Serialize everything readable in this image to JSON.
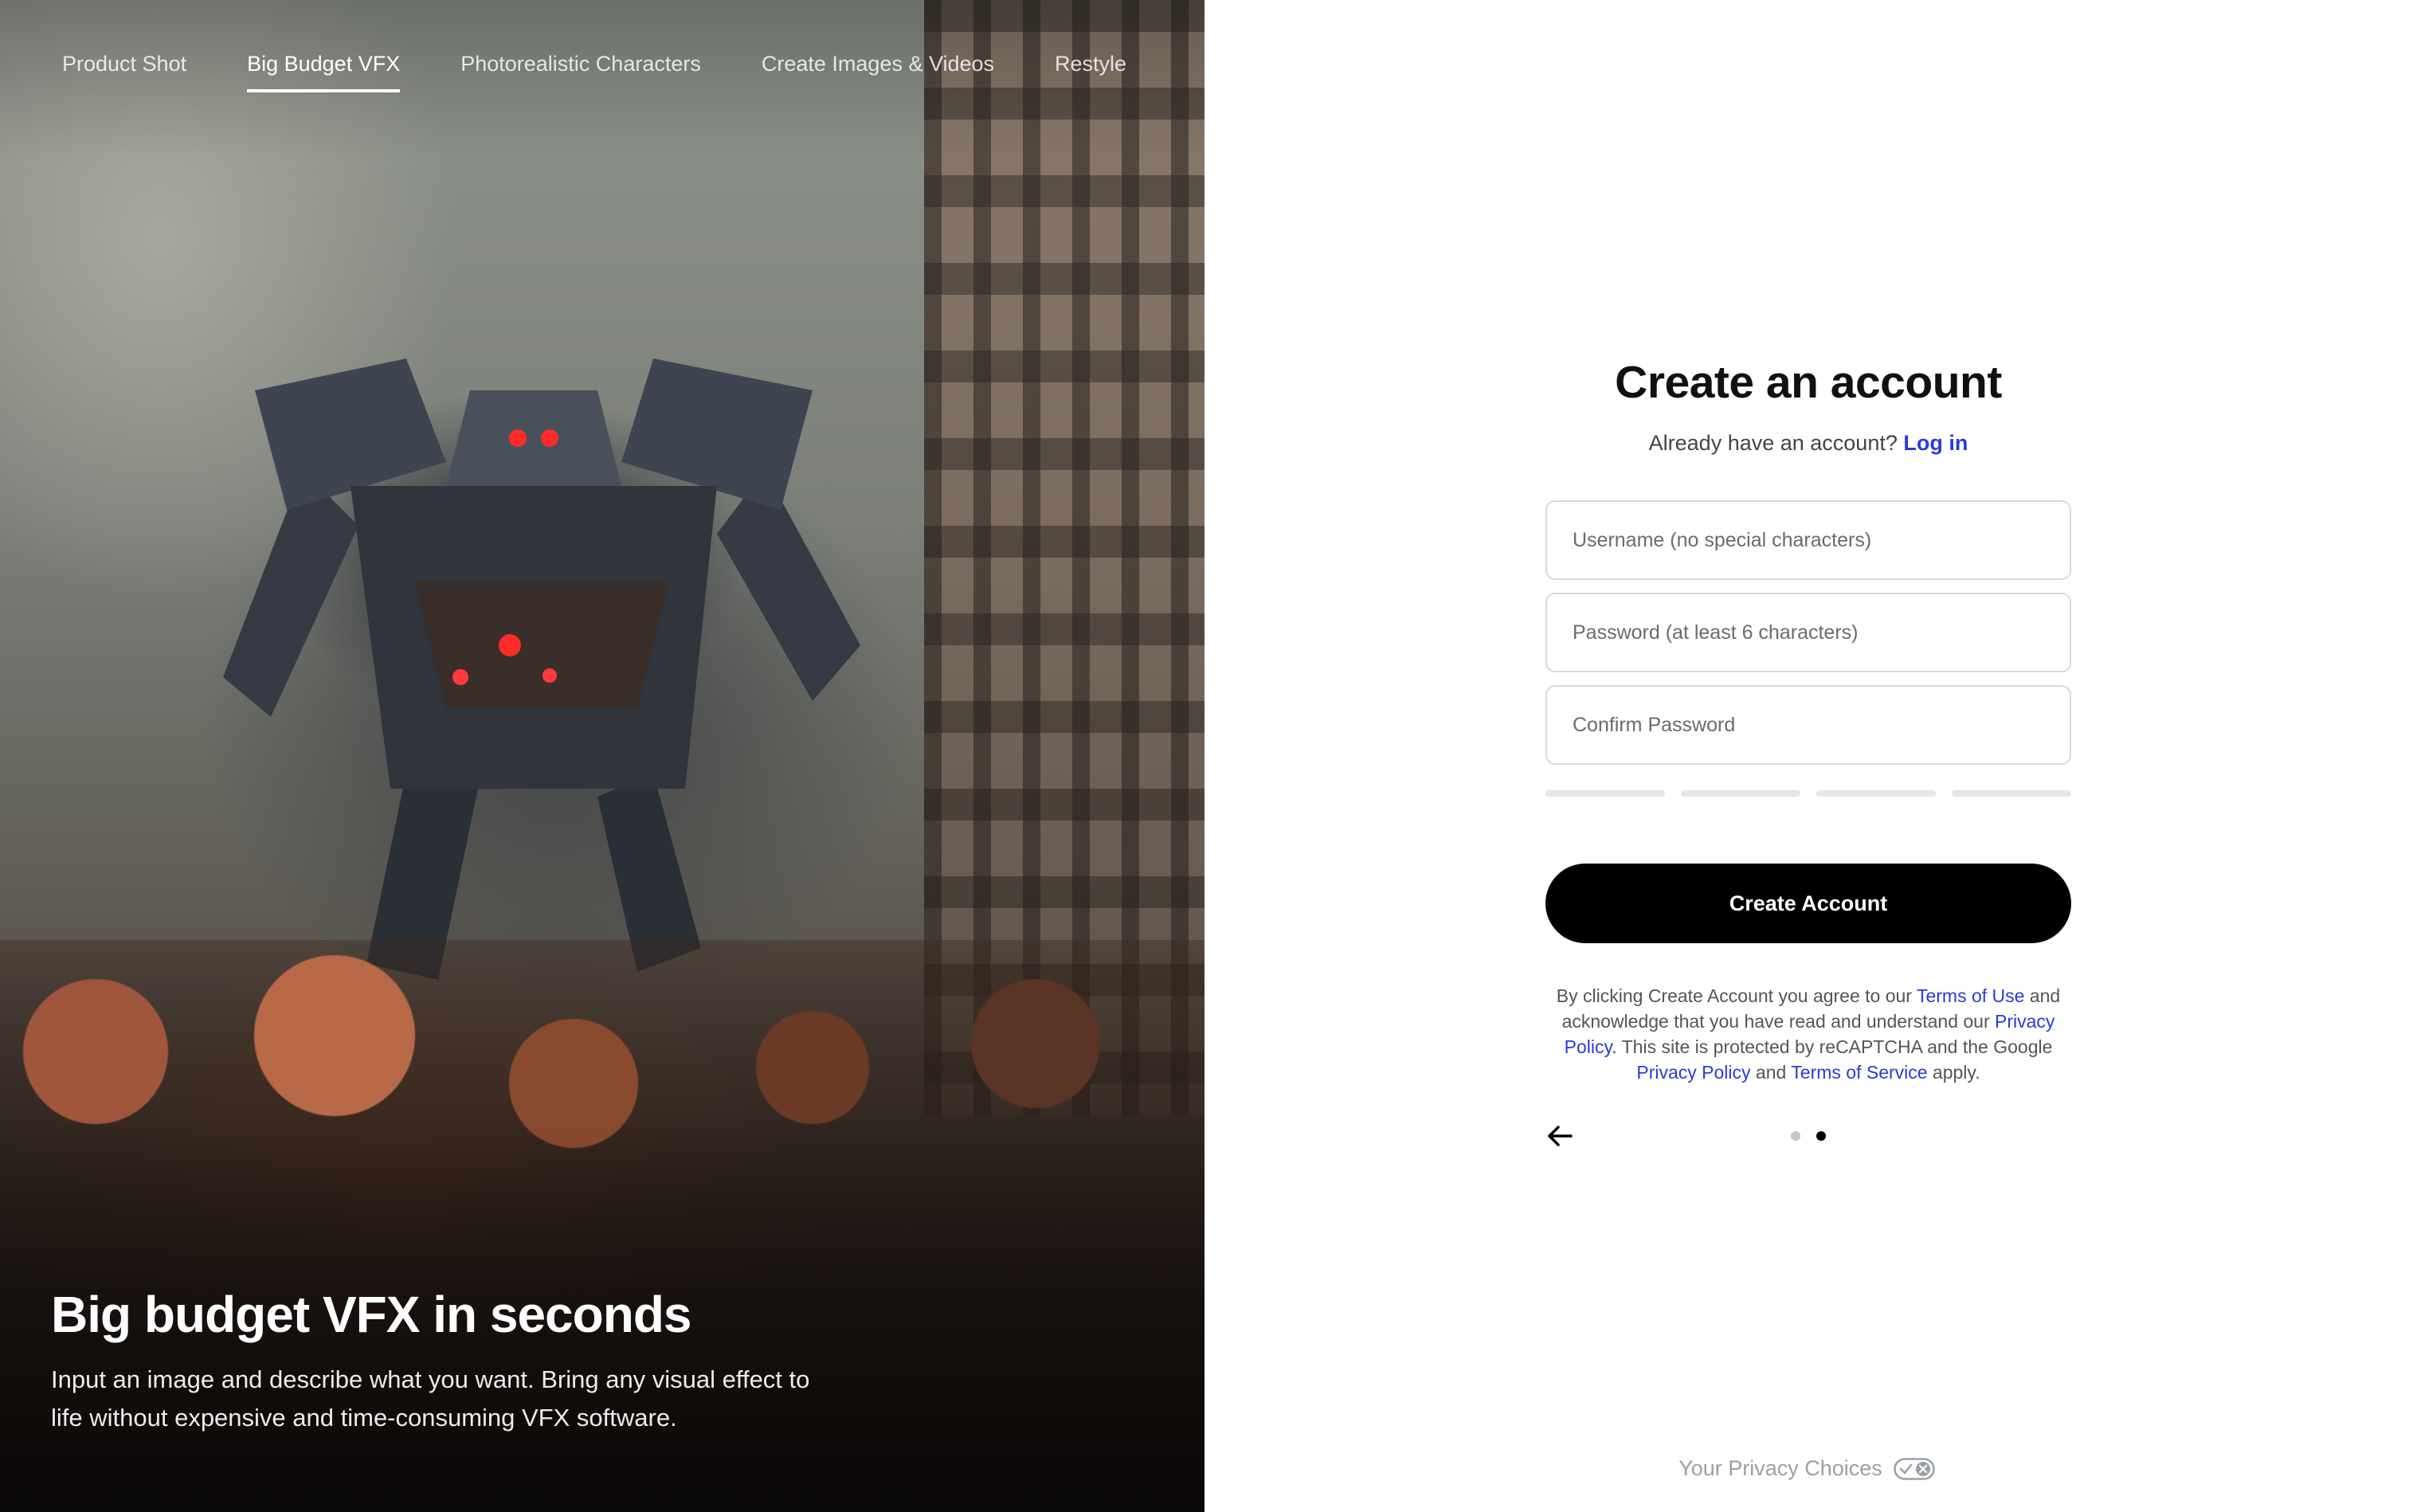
{
  "hero": {
    "tabs": [
      {
        "label": "Product Shot",
        "active": false
      },
      {
        "label": "Big Budget VFX",
        "active": true
      },
      {
        "label": "Photorealistic Characters",
        "active": false
      },
      {
        "label": "Create Images & Videos",
        "active": false
      },
      {
        "label": "Restyle",
        "active": false
      }
    ],
    "title": "Big budget VFX in seconds",
    "description": "Input an image and describe what you want. Bring any visual effect to life without expensive and time-consuming VFX software."
  },
  "form": {
    "title": "Create an account",
    "login_prompt": "Already have an account?",
    "login_link": "Log in",
    "fields": {
      "username_placeholder": "Username (no special characters)",
      "password_placeholder": "Password (at least 6 characters)",
      "confirm_placeholder": "Confirm Password"
    },
    "strength_segments": 4,
    "submit_label": "Create Account",
    "legal": {
      "part1": "By clicking Create Account you agree to our ",
      "terms_of_use": "Terms of Use",
      "part2": " and acknowledge that you have read and understand our ",
      "privacy_policy": "Privacy Policy",
      "part3": ". This site is protected by reCAPTCHA and the Google ",
      "google_privacy": "Privacy Policy",
      "part4": " and ",
      "google_terms": "Terms of Service",
      "part5": " apply."
    },
    "pager": {
      "total": 2,
      "current": 2
    }
  },
  "footer": {
    "privacy_choices": "Your Privacy Choices"
  },
  "colors": {
    "accent_link": "#2a3bd6",
    "button_bg": "#000000",
    "muted": "#9aa0a6"
  },
  "icons": {
    "back": "arrow-left-icon",
    "privacy": "privacy-toggle-icon"
  }
}
